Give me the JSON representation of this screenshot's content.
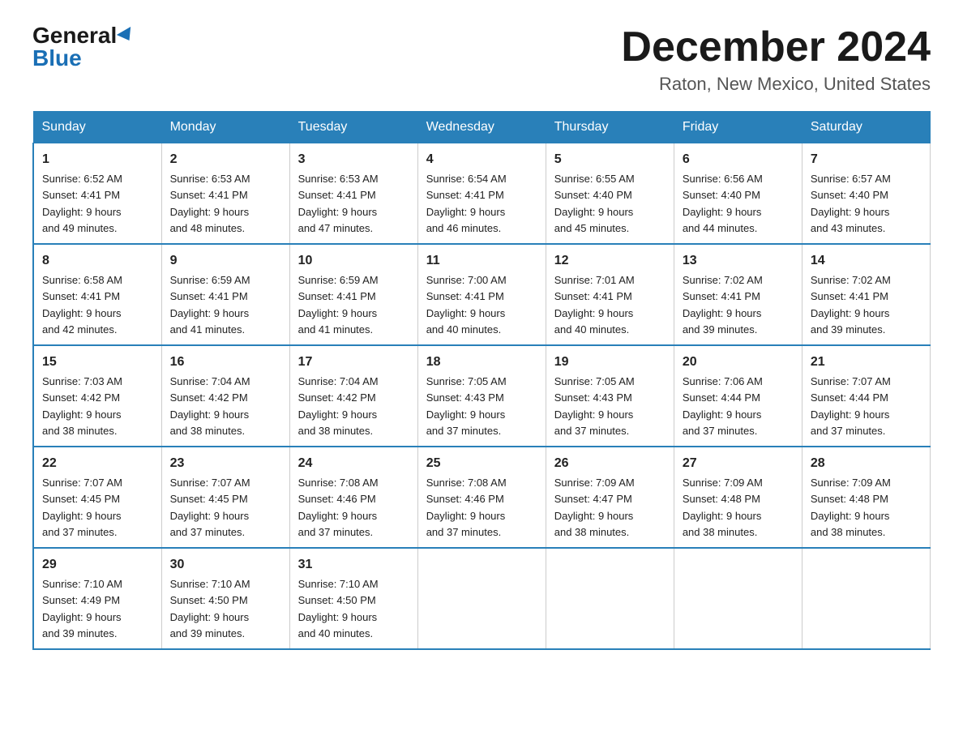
{
  "header": {
    "logo_general": "General",
    "logo_blue": "Blue",
    "title": "December 2024",
    "subtitle": "Raton, New Mexico, United States"
  },
  "weekdays": [
    "Sunday",
    "Monday",
    "Tuesday",
    "Wednesday",
    "Thursday",
    "Friday",
    "Saturday"
  ],
  "weeks": [
    [
      {
        "day": "1",
        "sunrise": "6:52 AM",
        "sunset": "4:41 PM",
        "daylight": "9 hours and 49 minutes."
      },
      {
        "day": "2",
        "sunrise": "6:53 AM",
        "sunset": "4:41 PM",
        "daylight": "9 hours and 48 minutes."
      },
      {
        "day": "3",
        "sunrise": "6:53 AM",
        "sunset": "4:41 PM",
        "daylight": "9 hours and 47 minutes."
      },
      {
        "day": "4",
        "sunrise": "6:54 AM",
        "sunset": "4:41 PM",
        "daylight": "9 hours and 46 minutes."
      },
      {
        "day": "5",
        "sunrise": "6:55 AM",
        "sunset": "4:40 PM",
        "daylight": "9 hours and 45 minutes."
      },
      {
        "day": "6",
        "sunrise": "6:56 AM",
        "sunset": "4:40 PM",
        "daylight": "9 hours and 44 minutes."
      },
      {
        "day": "7",
        "sunrise": "6:57 AM",
        "sunset": "4:40 PM",
        "daylight": "9 hours and 43 minutes."
      }
    ],
    [
      {
        "day": "8",
        "sunrise": "6:58 AM",
        "sunset": "4:41 PM",
        "daylight": "9 hours and 42 minutes."
      },
      {
        "day": "9",
        "sunrise": "6:59 AM",
        "sunset": "4:41 PM",
        "daylight": "9 hours and 41 minutes."
      },
      {
        "day": "10",
        "sunrise": "6:59 AM",
        "sunset": "4:41 PM",
        "daylight": "9 hours and 41 minutes."
      },
      {
        "day": "11",
        "sunrise": "7:00 AM",
        "sunset": "4:41 PM",
        "daylight": "9 hours and 40 minutes."
      },
      {
        "day": "12",
        "sunrise": "7:01 AM",
        "sunset": "4:41 PM",
        "daylight": "9 hours and 40 minutes."
      },
      {
        "day": "13",
        "sunrise": "7:02 AM",
        "sunset": "4:41 PM",
        "daylight": "9 hours and 39 minutes."
      },
      {
        "day": "14",
        "sunrise": "7:02 AM",
        "sunset": "4:41 PM",
        "daylight": "9 hours and 39 minutes."
      }
    ],
    [
      {
        "day": "15",
        "sunrise": "7:03 AM",
        "sunset": "4:42 PM",
        "daylight": "9 hours and 38 minutes."
      },
      {
        "day": "16",
        "sunrise": "7:04 AM",
        "sunset": "4:42 PM",
        "daylight": "9 hours and 38 minutes."
      },
      {
        "day": "17",
        "sunrise": "7:04 AM",
        "sunset": "4:42 PM",
        "daylight": "9 hours and 38 minutes."
      },
      {
        "day": "18",
        "sunrise": "7:05 AM",
        "sunset": "4:43 PM",
        "daylight": "9 hours and 37 minutes."
      },
      {
        "day": "19",
        "sunrise": "7:05 AM",
        "sunset": "4:43 PM",
        "daylight": "9 hours and 37 minutes."
      },
      {
        "day": "20",
        "sunrise": "7:06 AM",
        "sunset": "4:44 PM",
        "daylight": "9 hours and 37 minutes."
      },
      {
        "day": "21",
        "sunrise": "7:07 AM",
        "sunset": "4:44 PM",
        "daylight": "9 hours and 37 minutes."
      }
    ],
    [
      {
        "day": "22",
        "sunrise": "7:07 AM",
        "sunset": "4:45 PM",
        "daylight": "9 hours and 37 minutes."
      },
      {
        "day": "23",
        "sunrise": "7:07 AM",
        "sunset": "4:45 PM",
        "daylight": "9 hours and 37 minutes."
      },
      {
        "day": "24",
        "sunrise": "7:08 AM",
        "sunset": "4:46 PM",
        "daylight": "9 hours and 37 minutes."
      },
      {
        "day": "25",
        "sunrise": "7:08 AM",
        "sunset": "4:46 PM",
        "daylight": "9 hours and 37 minutes."
      },
      {
        "day": "26",
        "sunrise": "7:09 AM",
        "sunset": "4:47 PM",
        "daylight": "9 hours and 38 minutes."
      },
      {
        "day": "27",
        "sunrise": "7:09 AM",
        "sunset": "4:48 PM",
        "daylight": "9 hours and 38 minutes."
      },
      {
        "day": "28",
        "sunrise": "7:09 AM",
        "sunset": "4:48 PM",
        "daylight": "9 hours and 38 minutes."
      }
    ],
    [
      {
        "day": "29",
        "sunrise": "7:10 AM",
        "sunset": "4:49 PM",
        "daylight": "9 hours and 39 minutes."
      },
      {
        "day": "30",
        "sunrise": "7:10 AM",
        "sunset": "4:50 PM",
        "daylight": "9 hours and 39 minutes."
      },
      {
        "day": "31",
        "sunrise": "7:10 AM",
        "sunset": "4:50 PM",
        "daylight": "9 hours and 40 minutes."
      },
      null,
      null,
      null,
      null
    ]
  ],
  "labels": {
    "sunrise": "Sunrise:",
    "sunset": "Sunset:",
    "daylight": "Daylight:"
  }
}
